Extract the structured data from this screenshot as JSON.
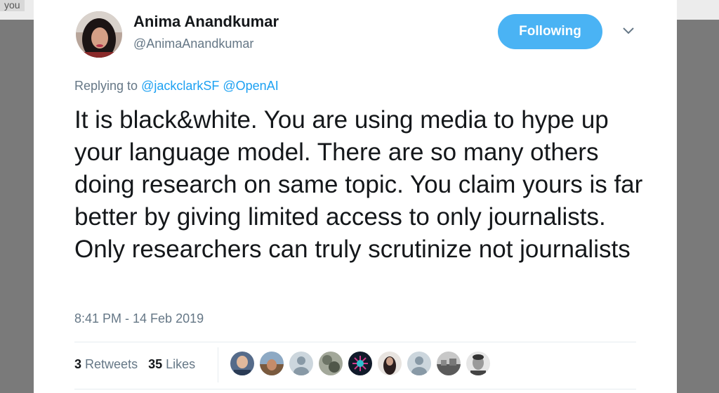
{
  "background": {
    "tag": "you"
  },
  "tweet": {
    "author": {
      "name": "Anima Anandkumar",
      "handle": "@AnimaAnandkumar"
    },
    "follow_button": "Following",
    "replying_prefix": "Replying to",
    "replying_to": [
      "@jackclarkSF",
      "@OpenAI"
    ],
    "text": "It is black&white. You are using media to hype up your language model. There are so many others doing research on same topic. You claim yours is far better by giving limited access to only journalists.  Only researchers can truly scrutinize not journalists",
    "timestamp": "8:41 PM - 14 Feb 2019",
    "retweets": {
      "count": "3",
      "label": "Retweets"
    },
    "likes": {
      "count": "35",
      "label": "Likes"
    }
  },
  "colors": {
    "accent": "#1da1f2",
    "button": "#4ab3f4",
    "muted": "#657786",
    "text": "#14171a"
  },
  "icons": [
    "chevron-down-icon",
    "default-avatar-icon"
  ]
}
